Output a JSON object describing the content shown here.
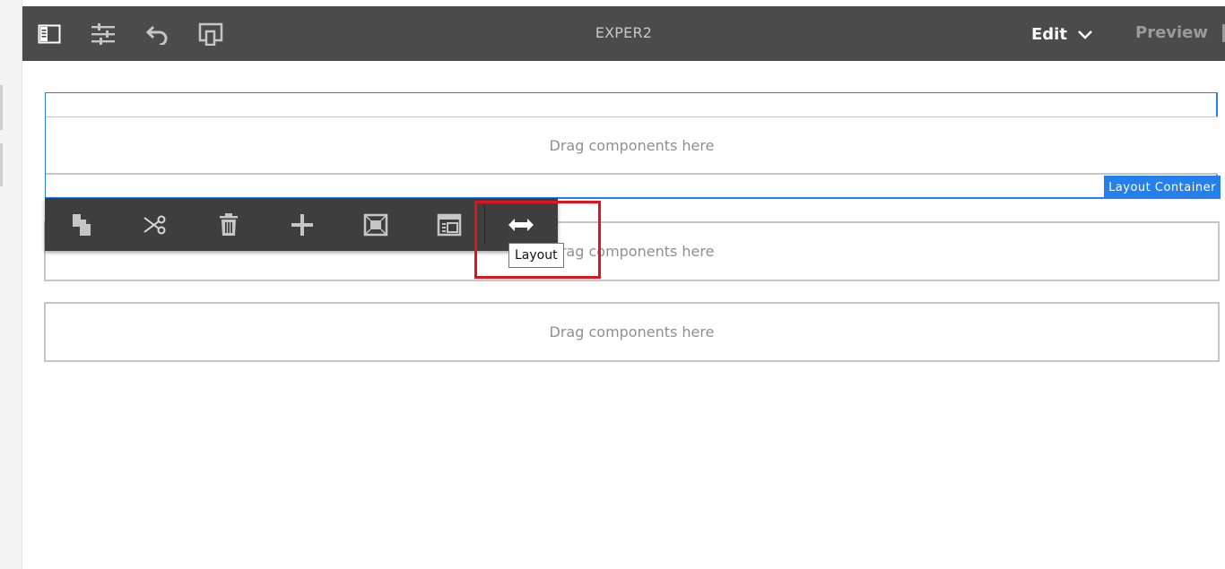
{
  "topbar": {
    "title": "EXPER2",
    "edit_label": "Edit",
    "preview_label": "Preview",
    "icons": [
      "side-panel-icon",
      "properties-icon",
      "undo-icon",
      "emulator-icon"
    ]
  },
  "container": {
    "label": "Layout Container",
    "placeholder": "Drag components here"
  },
  "dropzones": [
    {
      "text": "Drag components here"
    },
    {
      "text": "Drag components here"
    },
    {
      "text": "Drag components here"
    }
  ],
  "toolbar": {
    "items": [
      "copy-icon",
      "cut-icon",
      "delete-icon",
      "insert-icon",
      "group-icon",
      "parent-icon",
      "layout-icon"
    ],
    "tooltip": "Layout"
  },
  "colors": {
    "topbar": "#4b4b4b",
    "accent": "#2680eb",
    "toolbar": "#3e3e3e",
    "highlight": "#e0141e"
  }
}
